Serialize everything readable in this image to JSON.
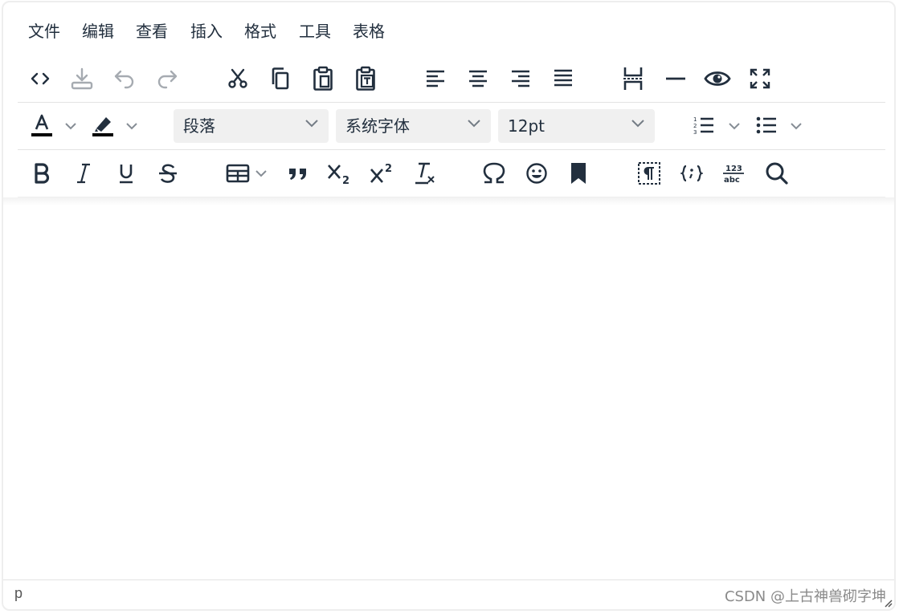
{
  "menubar": {
    "items": [
      "文件",
      "编辑",
      "查看",
      "插入",
      "格式",
      "工具",
      "表格"
    ]
  },
  "toolbar": {
    "row1": [
      "source-code-icon",
      "save-icon",
      "undo-icon",
      "redo-icon",
      "cut-icon",
      "copy-icon",
      "paste-icon",
      "paste-text-icon",
      "align-left-icon",
      "align-center-icon",
      "align-right-icon",
      "align-justify-icon",
      "page-break-icon",
      "horizontal-rule-icon",
      "preview-icon",
      "fullscreen-icon"
    ],
    "row2": {
      "block_format": "段落",
      "font_family": "系统字体",
      "font_size": "12pt"
    },
    "row3": [
      "bold-icon",
      "italic-icon",
      "underline-icon",
      "strikethrough-icon",
      "table-icon",
      "blockquote-icon",
      "subscript-icon",
      "superscript-icon",
      "remove-format-icon",
      "special-char-icon",
      "emoticons-icon",
      "bookmark-icon",
      "visual-blocks-icon",
      "template-icon",
      "word-count-icon",
      "search-replace-icon"
    ],
    "colors": {
      "text_color": "#000000",
      "highlight_color": "#000000",
      "icon_color": "#222f3e"
    }
  },
  "statusbar": {
    "path": "p",
    "watermark": "CSDN @上古神兽砌字坤"
  }
}
